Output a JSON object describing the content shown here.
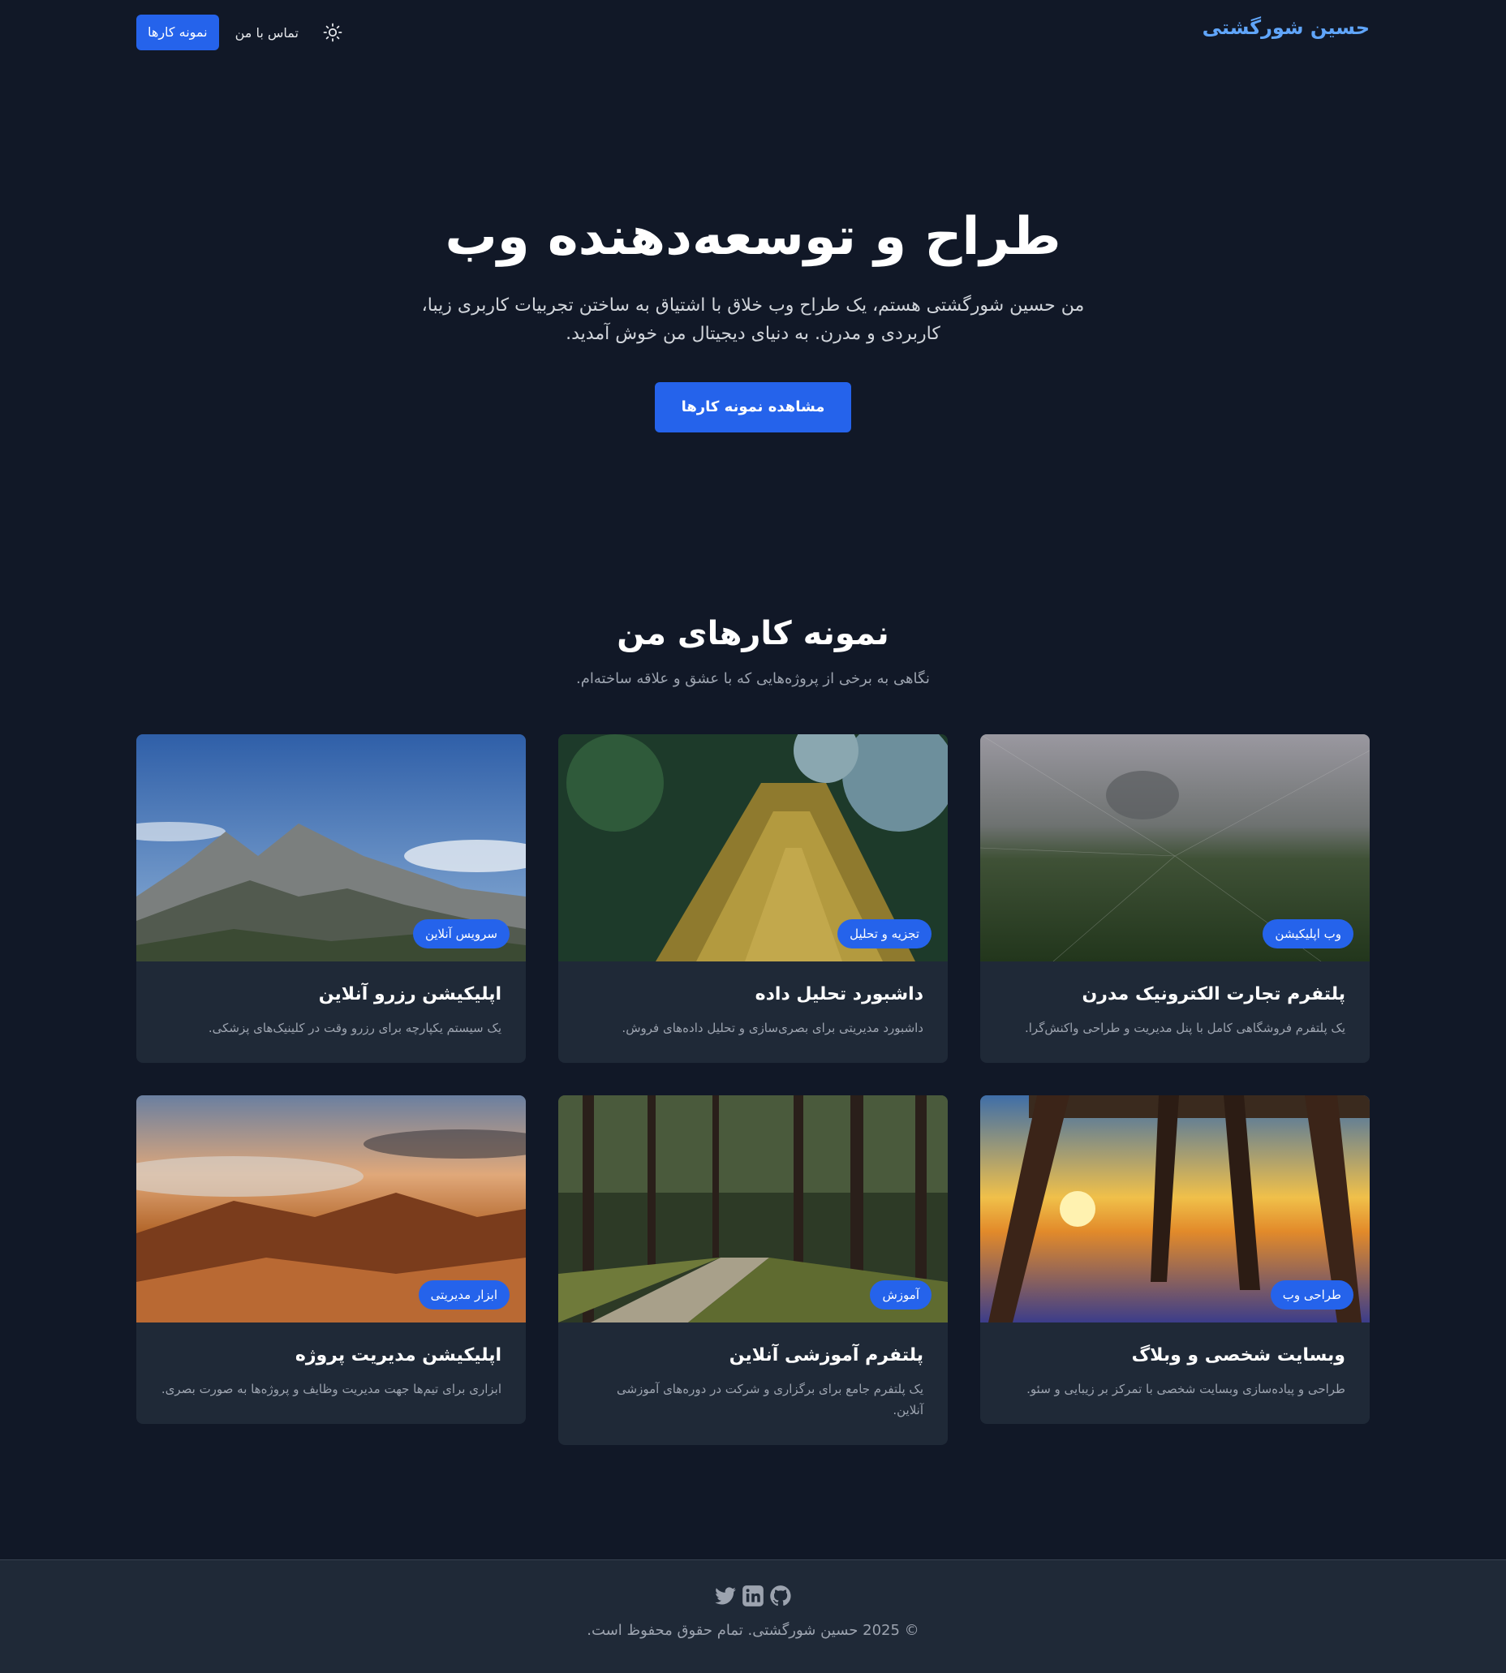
{
  "header": {
    "brand": "حسین شورگشتی",
    "nav": {
      "portfolio": "نمونه کارها",
      "contact": "تماس با من"
    },
    "theme_icon": "sun-icon"
  },
  "hero": {
    "title": "طراح و توسعه‌دهنده وب",
    "subtitle": "من حسین شورگشتی هستم، یک طراح وب خلاق با اشتیاق به ساختن تجربیات کاربری زیبا، کاربردی و مدرن. به دنیای دیجیتال من خوش آمدید.",
    "cta": "مشاهده نمونه کارها"
  },
  "portfolio": {
    "title": "نمونه کارهای من",
    "subtitle": "نگاهی به برخی از پروژه‌هایی که با عشق و علاقه ساخته‌ام.",
    "projects": [
      {
        "badge": "وب اپلیکیشن",
        "title": "پلتفرم تجارت الکترونیک مدرن",
        "description": "یک پلتفرم فروشگاهی کامل با پنل مدیریت و طراحی واکنش‌گرا."
      },
      {
        "badge": "تجزیه و تحلیل",
        "title": "داشبورد تحلیل داده",
        "description": "داشبورد مدیریتی برای بصری‌سازی و تحلیل داده‌های فروش."
      },
      {
        "badge": "سرویس آنلاین",
        "title": "اپلیکیشن رزرو آنلاین",
        "description": "یک سیستم یکپارچه برای رزرو وقت در کلینیک‌های پزشکی."
      },
      {
        "badge": "طراحی وب",
        "title": "وبسایت شخصی و وبلاگ",
        "description": "طراحی و پیاده‌سازی وبسایت شخصی با تمرکز بر زیبایی و سئو."
      },
      {
        "badge": "آموزش",
        "title": "پلتفرم آموزشی آنلاین",
        "description": "یک پلتفرم جامع برای برگزاری و شرکت در دوره‌های آموزشی آنلاین."
      },
      {
        "badge": "ابزار مدیریتی",
        "title": "اپلیکیشن مدیریت پروژه",
        "description": "ابزاری برای تیم‌ها جهت مدیریت وظایف و پروژه‌ها به صورت بصری."
      }
    ]
  },
  "footer": {
    "socials": [
      "github-icon",
      "linkedin-icon",
      "twitter-icon"
    ],
    "copyright": "© 2025 حسین شورگشتی. تمام حقوق محفوظ است."
  },
  "colors": {
    "background": "#111827",
    "surface": "#1f2937",
    "accent": "#2563eb",
    "brand": "#60a5fa"
  }
}
